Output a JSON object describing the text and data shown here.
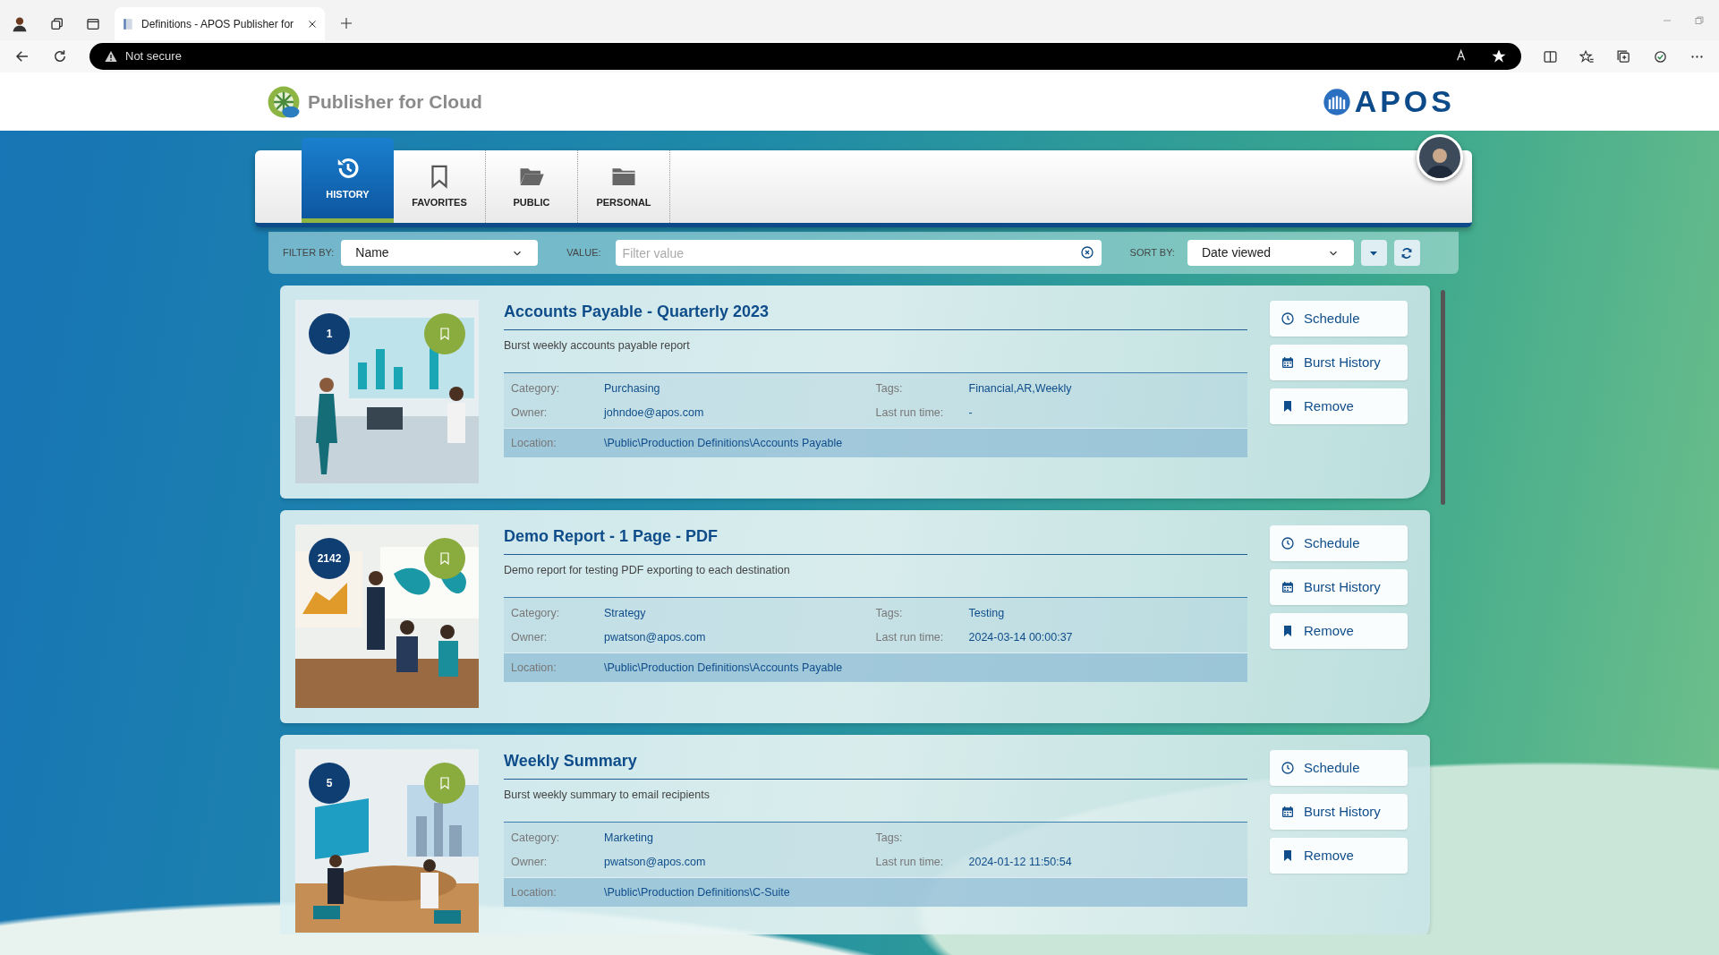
{
  "browser": {
    "tab_title": "Definitions - APOS Publisher for",
    "security": "Not secure"
  },
  "app": {
    "title": "Publisher for Cloud",
    "brand": "APOS"
  },
  "tabs": [
    {
      "label": "HISTORY",
      "kind": "history",
      "selected": true
    },
    {
      "label": "FAVORITES",
      "kind": "favorites",
      "selected": false
    },
    {
      "label": "PUBLIC",
      "kind": "public",
      "selected": false
    },
    {
      "label": "PERSONAL",
      "kind": "personal",
      "selected": false
    }
  ],
  "filter": {
    "filter_by_label": "FILTER BY:",
    "filter_by": "Name",
    "value_label": "VALUE:",
    "value_placeholder": "Filter value",
    "sort_by_label": "SORT BY:",
    "sort_by": "Date viewed"
  },
  "definitions": [
    {
      "count": "1",
      "title": "Accounts Payable - Quarterly 2023",
      "description": "Burst weekly accounts payable report",
      "details": [
        {
          "label": "Category:",
          "value": "Purchasing"
        },
        {
          "label": "Tags:",
          "value": "Financial,AR,Weekly"
        },
        {
          "label": "Owner:",
          "value": "johndoe@apos.com"
        },
        {
          "label": "Last run time:",
          "value": "-"
        }
      ],
      "location": {
        "label": "Location:",
        "value": "\\Public\\Production Definitions\\Accounts Payable"
      },
      "actions": [
        {
          "label": "Schedule",
          "kind": "schedule"
        },
        {
          "label": "Burst History",
          "kind": "history"
        },
        {
          "label": "Remove",
          "kind": "remove"
        }
      ]
    },
    {
      "count": "2142",
      "title": "Demo Report - 1 Page - PDF",
      "description": "Demo report for testing PDF exporting to each destination",
      "details": [
        {
          "label": "Category:",
          "value": "Strategy"
        },
        {
          "label": "Tags:",
          "value": "Testing"
        },
        {
          "label": "Owner:",
          "value": "pwatson@apos.com"
        },
        {
          "label": "Last run time:",
          "value": "2024-03-14 00:00:37"
        }
      ],
      "location": {
        "label": "Location:",
        "value": "\\Public\\Production Definitions\\Accounts Payable"
      },
      "actions": [
        {
          "label": "Schedule",
          "kind": "schedule"
        },
        {
          "label": "Burst History",
          "kind": "history"
        },
        {
          "label": "Remove",
          "kind": "remove"
        }
      ]
    },
    {
      "count": "5",
      "title": "Weekly Summary",
      "description": "Burst weekly summary to email recipients",
      "details": [
        {
          "label": "Category:",
          "value": "Marketing"
        },
        {
          "label": "Tags:"
        },
        {
          "label": "Owner:",
          "value": "pwatson@apos.com"
        },
        {
          "label": "Last run time:",
          "value": "2024-01-12 11:50:54"
        }
      ],
      "location": {
        "label": "Location:",
        "value": "\\Public\\Production Definitions\\C-Suite"
      },
      "actions": [
        {
          "label": "Schedule",
          "kind": "schedule"
        },
        {
          "label": "Burst History",
          "kind": "history"
        },
        {
          "label": "Remove",
          "kind": "remove"
        }
      ]
    }
  ]
}
